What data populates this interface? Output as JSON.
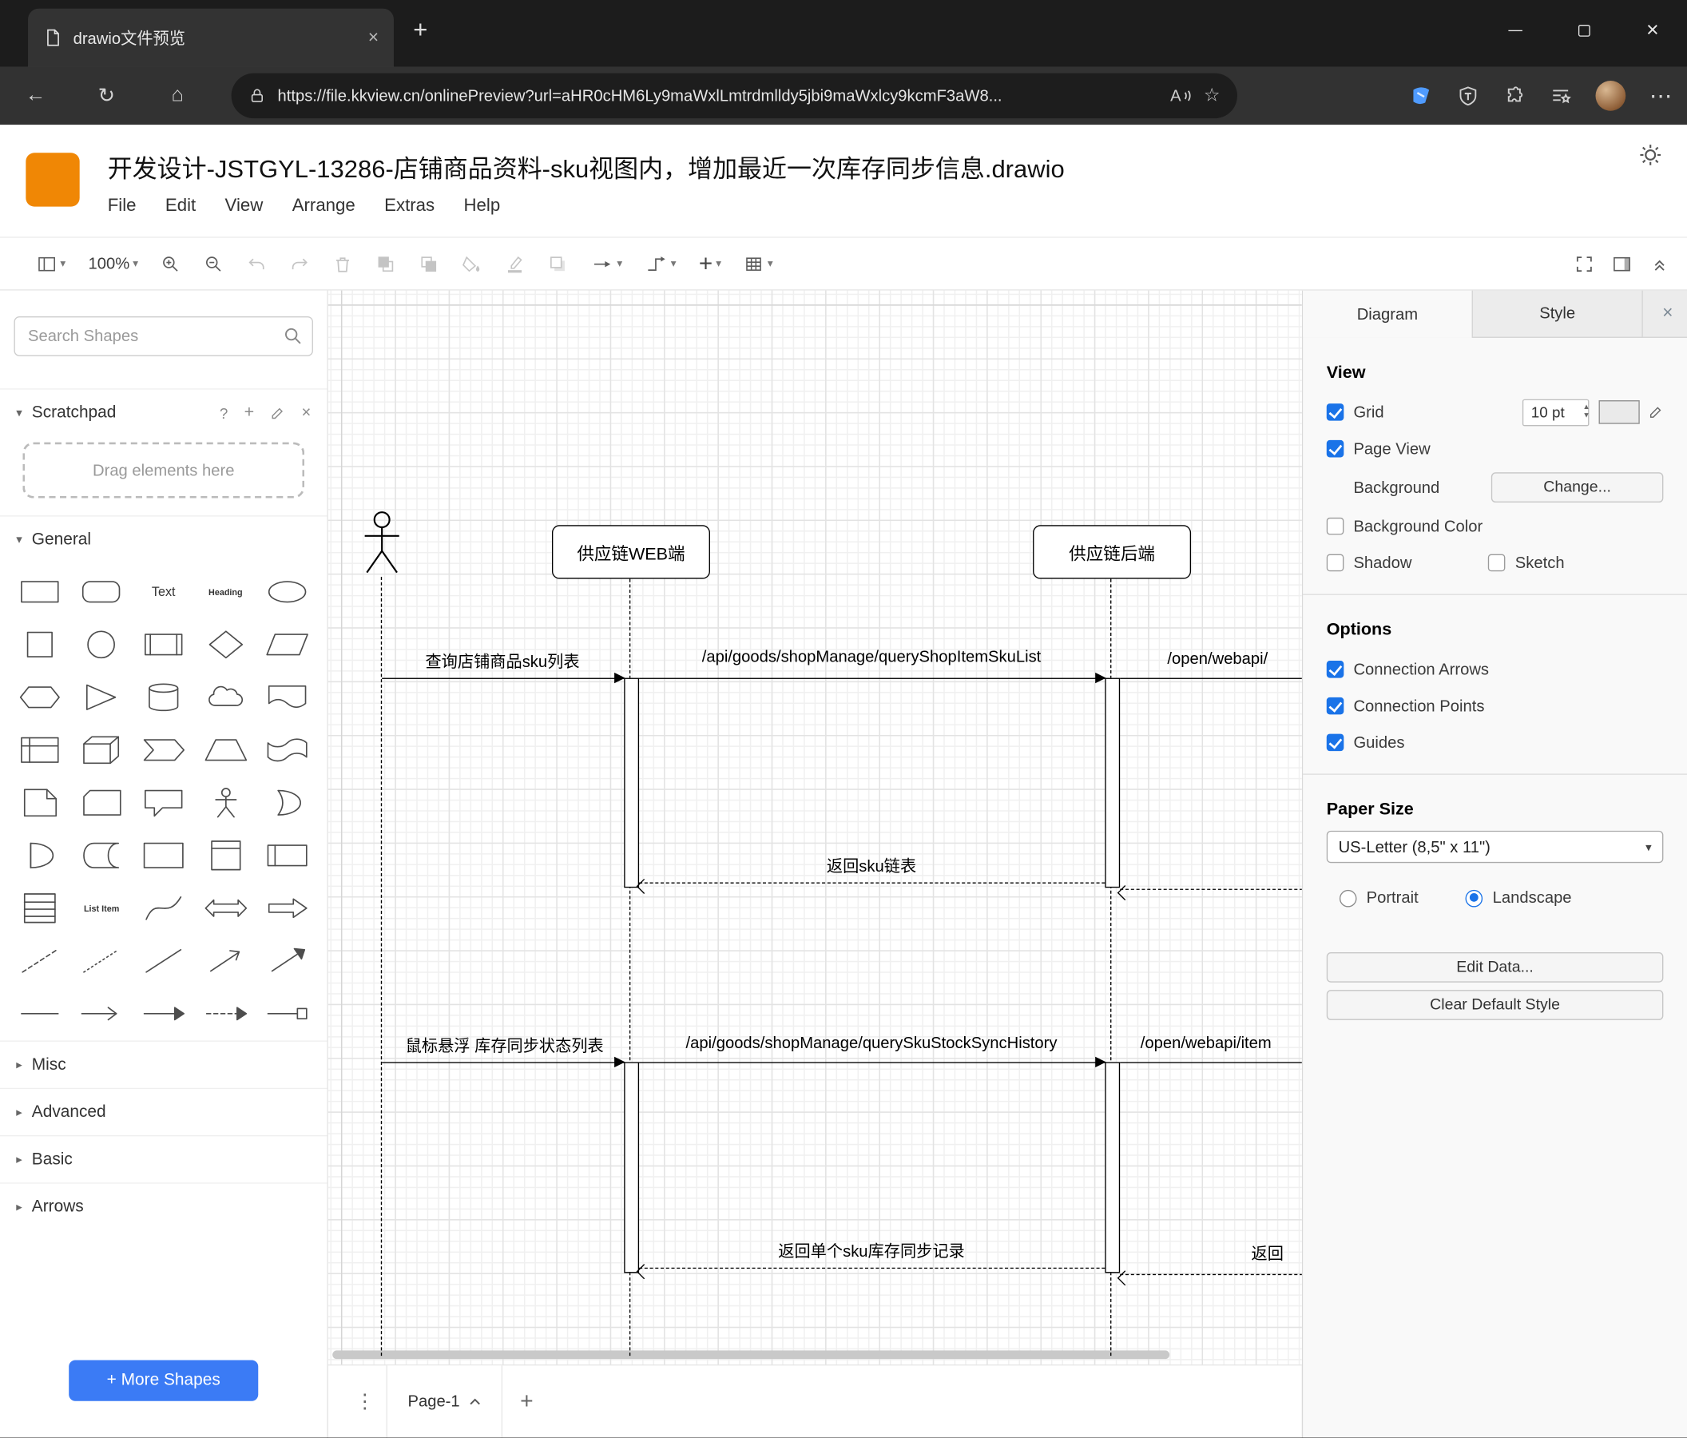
{
  "colors": {
    "brand": "#f08705",
    "accent": "#3b7bf5",
    "check": "#1a73e8"
  },
  "icons": {
    "close": "×",
    "plus": "+",
    "back": "←",
    "refresh": "↻",
    "home": "⌂",
    "star": "☆",
    "more": "⋯",
    "kebab": "⋮",
    "caret_down": "▾",
    "caret_right": "▸",
    "help": "?",
    "pin_add": "+"
  },
  "browser": {
    "tab_title": "drawio文件预览",
    "url": "https://file.kkview.cn/onlinePreview?url=aHR0cHM6Ly9maWxlLmtrdmlldy5jbi9maWxlcy9kcmF3aW8..."
  },
  "app": {
    "file_name": "开发设计-JSTGYL-13286-店铺商品资料-sku视图内，增加最近一次库存同步信息.drawio",
    "menus": [
      "File",
      "Edit",
      "View",
      "Arrange",
      "Extras",
      "Help"
    ],
    "zoom": "100%"
  },
  "shapes": {
    "search_placeholder": "Search Shapes",
    "scratchpad": "Scratchpad",
    "drag_hint": "Drag elements here",
    "sections": [
      "General",
      "Misc",
      "Advanced",
      "Basic",
      "Arrows"
    ],
    "text_label": "Text",
    "heading_label": "Heading",
    "list_item_label": "List Item",
    "more_shapes": "+ More Shapes"
  },
  "canvas": {
    "page_tab": "Page-1"
  },
  "diagram": {
    "actors": [
      "供应链WEB端",
      "供应链后端"
    ],
    "messages": [
      "查询店铺商品sku列表",
      "/api/goods/shopManage/queryShopItemSkuList",
      "/open/webapi/",
      "返回sku链表",
      "鼠标悬浮 库存同步状态列表",
      "/api/goods/shopManage/querySkuStockSyncHistory",
      "/open/webapi/item",
      "返回单个sku库存同步记录",
      "返回"
    ]
  },
  "format_panel": {
    "tab_diagram": "Diagram",
    "tab_style": "Style",
    "view": {
      "title": "View",
      "grid": "Grid",
      "grid_size": "10 pt",
      "page_view": "Page View",
      "background": "Background",
      "change": "Change...",
      "background_color": "Background Color",
      "shadow": "Shadow",
      "sketch": "Sketch"
    },
    "options": {
      "title": "Options",
      "connection_arrows": "Connection Arrows",
      "connection_points": "Connection Points",
      "guides": "Guides"
    },
    "paper": {
      "title": "Paper Size",
      "paper_size": "US-Letter (8,5\" x 11\")",
      "portrait": "Portrait",
      "landscape": "Landscape"
    },
    "buttons": {
      "edit_data": "Edit Data...",
      "clear_style": "Clear Default Style"
    }
  }
}
